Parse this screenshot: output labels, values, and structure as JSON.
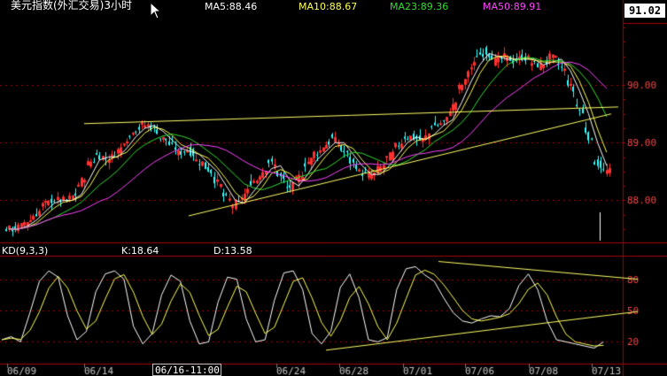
{
  "header": {
    "title": "美元指数(外汇交易)3小时",
    "ma_labels": [
      {
        "text": "MA5:88.46",
        "color": "#ffffff"
      },
      {
        "text": "MA10:88.67",
        "color": "#ffff55"
      },
      {
        "text": "MA23:89.36",
        "color": "#33dd33"
      },
      {
        "text": "MA50:89.91",
        "color": "#ff44ff"
      }
    ],
    "current_price": "91.02"
  },
  "indicator": {
    "name": "KD(9,3,3)",
    "k_label": "K:18.64",
    "d_label": "D:13.58"
  },
  "cursor_date": "06/16-11:00",
  "colors": {
    "up_candle": "#ff3030",
    "down_candle": "#30ffff",
    "trendline": "#ffff66",
    "grid": "#aa0000",
    "axis_text": "#ff4444"
  },
  "chart_data": [
    {
      "type": "candlestick",
      "title": "美元指数(外汇交易)3小时",
      "ylim": [
        87.3,
        91.2
      ],
      "y_ticks": [
        88.0,
        89.0,
        90.0
      ],
      "x_ticks": [
        "06/09",
        "06/14",
        "06/16-11:00",
        "06/24",
        "06/28",
        "07/01",
        "07/06",
        "07/08",
        "07/13"
      ],
      "grid": true,
      "close_series_approx": [
        87.5,
        87.5,
        87.6,
        87.7,
        87.9,
        88.0,
        88.0,
        88.0,
        88.2,
        88.6,
        88.8,
        88.7,
        88.8,
        89.0,
        89.2,
        89.3,
        89.3,
        89.1,
        89.0,
        88.8,
        88.9,
        88.7,
        88.6,
        88.4,
        88.1,
        87.9,
        88.0,
        88.3,
        88.4,
        88.7,
        88.5,
        88.2,
        88.3,
        88.6,
        88.8,
        88.9,
        89.1,
        88.9,
        88.7,
        88.5,
        88.4,
        88.5,
        88.7,
        88.9,
        89.1,
        89.1,
        89.0,
        89.3,
        89.3,
        89.5,
        89.9,
        90.2,
        90.5,
        90.6,
        90.4,
        90.5,
        90.4,
        90.5,
        90.4,
        90.3,
        90.5,
        90.4,
        90.1,
        89.7,
        89.3,
        88.7,
        88.5
      ],
      "series": [
        {
          "name": "MA5",
          "last": 88.46
        },
        {
          "name": "MA10",
          "last": 88.67
        },
        {
          "name": "MA23",
          "last": 89.36
        },
        {
          "name": "MA50",
          "last": 89.91
        }
      ],
      "annotations": [
        "ascending support trendline",
        "resistance line ~89.6"
      ]
    },
    {
      "type": "line",
      "title": "KD(9,3,3)",
      "ylim": [
        0,
        100
      ],
      "y_ticks": [
        20,
        50,
        80
      ],
      "x_ticks": [
        "06/09",
        "06/14",
        "06/16-11:00",
        "06/24",
        "06/28",
        "07/01",
        "07/06",
        "07/08",
        "07/13"
      ],
      "series": [
        {
          "name": "K",
          "last": 18.64
        },
        {
          "name": "D",
          "last": 13.58
        }
      ],
      "k_series_approx": [
        22,
        25,
        20,
        48,
        78,
        88,
        82,
        45,
        22,
        30,
        68,
        85,
        88,
        80,
        35,
        18,
        28,
        65,
        84,
        78,
        40,
        18,
        20,
        58,
        82,
        80,
        42,
        20,
        22,
        60,
        86,
        88,
        70,
        28,
        18,
        30,
        72,
        85,
        62,
        22,
        20,
        24,
        70,
        90,
        92,
        84,
        78,
        62,
        48,
        40,
        38,
        42,
        45,
        44,
        52,
        74,
        85,
        70,
        40,
        22,
        20,
        18,
        16,
        14,
        20
      ]
    }
  ]
}
